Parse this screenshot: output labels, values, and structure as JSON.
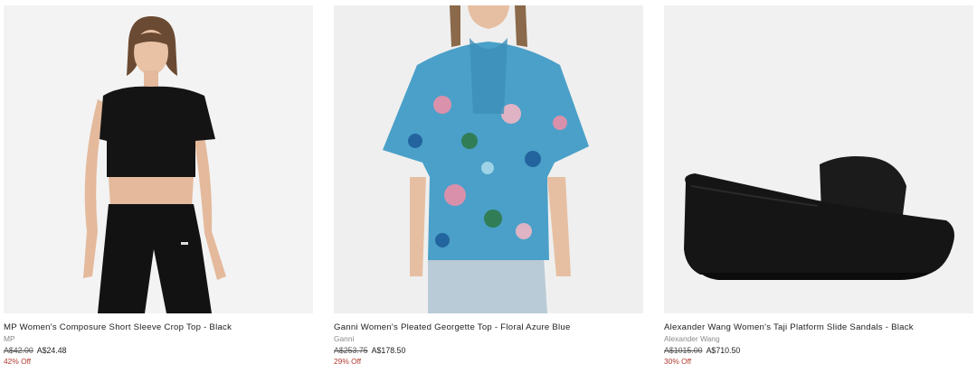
{
  "products": [
    {
      "image_alt": "MP Women's Composure Short Sleeve Crop Top - Black",
      "title": "MP Women's Composure Short Sleeve Crop Top - Black",
      "brand": "MP",
      "was_price": "A$42.00",
      "price": "A$24.48",
      "discount": "42% Off"
    },
    {
      "image_alt": "Ganni Women's Pleated Georgette Top - Floral Azure Blue",
      "title": "Ganni Women's Pleated Georgette Top - Floral Azure Blue",
      "brand": "Ganni",
      "was_price": "A$253.75",
      "price": "A$178.50",
      "discount": "29% Off"
    },
    {
      "image_alt": "Alexander Wang Women's Taji Platform Slide Sandals - Black",
      "title": "Alexander Wang Women's Taji Platform Slide Sandals - Black",
      "brand": "Alexander Wang",
      "was_price": "A$1015.00",
      "price": "A$710.50",
      "discount": "30% Off"
    }
  ],
  "colors": {
    "image_bg": "#f1f1f1",
    "discount": "#b03a2e",
    "brand": "#8a8a8a"
  }
}
